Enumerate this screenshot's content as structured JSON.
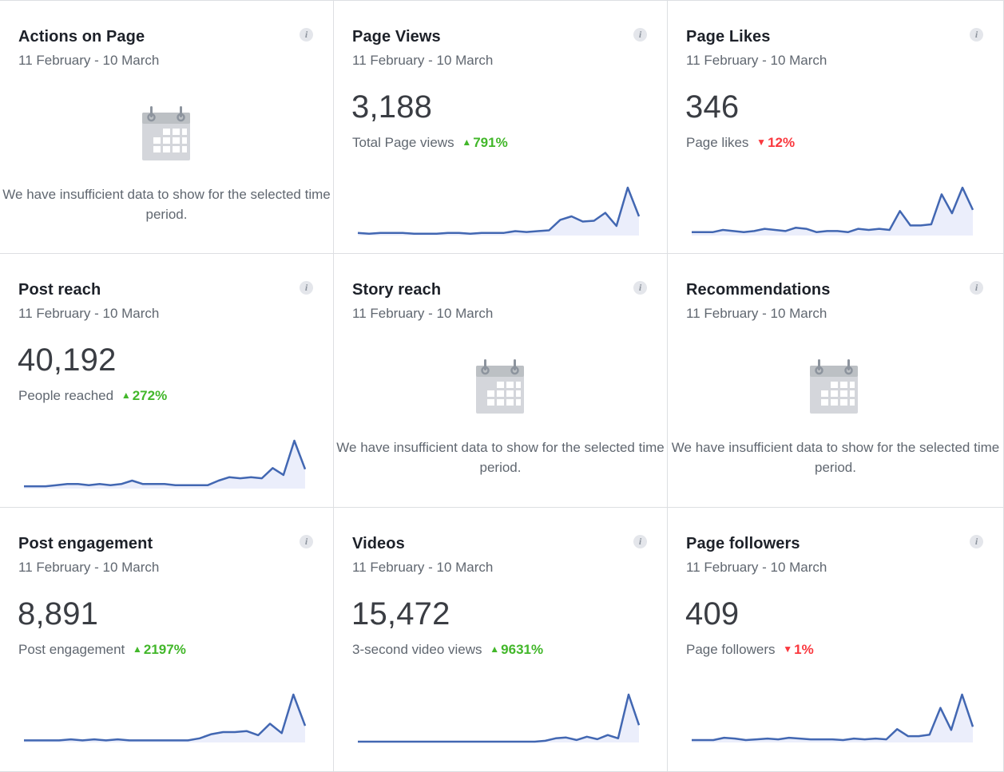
{
  "cards": [
    {
      "title": "Actions on Page",
      "date": "11 February - 10 March",
      "empty": true,
      "empty_text": "We have insufficient data to show for the selected time period."
    },
    {
      "title": "Page Views",
      "date": "11 February - 10 March",
      "value": "3,188",
      "label": "Total Page views",
      "change": "791%",
      "direction": "up",
      "trend": [
        3,
        2,
        3,
        3,
        3,
        2,
        2,
        2,
        3,
        3,
        2,
        3,
        3,
        3,
        5,
        4,
        5,
        6,
        18,
        22,
        16,
        17,
        26,
        11,
        55,
        22
      ]
    },
    {
      "title": "Page Likes",
      "date": "11 February - 10 March",
      "value": "346",
      "label": "Page likes",
      "change": "12%",
      "direction": "down",
      "trend": [
        3,
        3,
        3,
        5,
        4,
        3,
        4,
        6,
        5,
        4,
        7,
        6,
        3,
        4,
        4,
        3,
        6,
        5,
        6,
        5,
        22,
        9,
        9,
        10,
        37,
        20,
        43,
        23
      ]
    },
    {
      "title": "Post reach",
      "date": "11 February - 10 March",
      "value": "40,192",
      "label": "People reached",
      "change": "272%",
      "direction": "up",
      "trend": [
        2,
        2,
        2,
        3,
        4,
        4,
        3,
        4,
        3,
        4,
        7,
        4,
        4,
        4,
        3,
        3,
        3,
        3,
        7,
        10,
        9,
        10,
        9,
        18,
        12,
        42,
        17
      ]
    },
    {
      "title": "Story reach",
      "date": "11 February - 10 March",
      "empty": true,
      "empty_text": "We have insufficient data to show for the selected time period."
    },
    {
      "title": "Recommendations",
      "date": "11 February - 10 March",
      "empty": true,
      "empty_text": "We have insufficient data to show for the selected time period."
    },
    {
      "title": "Post engagement",
      "date": "11 February - 10 March",
      "value": "8,891",
      "label": "Post engagement",
      "change": "2197%",
      "direction": "up",
      "trend": [
        2,
        2,
        2,
        2,
        3,
        2,
        3,
        2,
        3,
        2,
        2,
        2,
        2,
        2,
        2,
        4,
        8,
        10,
        10,
        11,
        7,
        18,
        9,
        46,
        16
      ]
    },
    {
      "title": "Videos",
      "date": "11 February - 10 March",
      "value": "15,472",
      "label": "3-second video views",
      "change": "9631%",
      "direction": "up",
      "trend": [
        1,
        1,
        1,
        1,
        1,
        1,
        1,
        1,
        1,
        1,
        1,
        1,
        1,
        1,
        1,
        1,
        1,
        1,
        2,
        5,
        6,
        3,
        7,
        4,
        9,
        5,
        58,
        21
      ]
    },
    {
      "title": "Page followers",
      "date": "11 February - 10 March",
      "value": "409",
      "label": "Page followers",
      "change": "1%",
      "direction": "down",
      "trend": [
        3,
        3,
        3,
        6,
        5,
        3,
        4,
        5,
        4,
        6,
        5,
        4,
        4,
        4,
        3,
        5,
        4,
        5,
        4,
        17,
        8,
        8,
        10,
        44,
        16,
        61,
        20
      ]
    }
  ],
  "colors": {
    "line": "#4267b2",
    "fill": "#ebeefb",
    "up": "#42b72a",
    "down": "#fa383e"
  },
  "icons": {
    "info": "info-icon",
    "empty": "calendar-icon",
    "up": "triangle-up-icon",
    "down": "triangle-down-icon"
  }
}
